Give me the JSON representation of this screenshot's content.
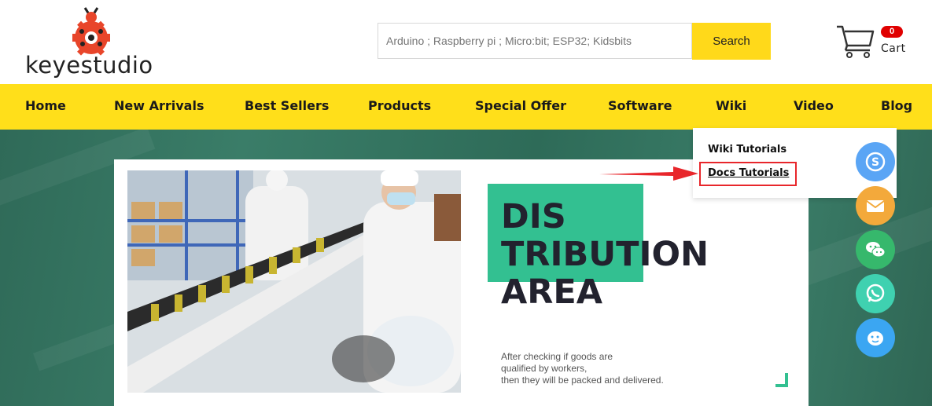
{
  "brand": {
    "name": "keyestudio",
    "colors": {
      "logo_red": "#e8452a",
      "accent_yellow": "#ffdf1a",
      "hero_green": "#33c091"
    }
  },
  "search": {
    "placeholder": "Arduino ; Raspberry pi ; Micro:bit; ESP32; Kidsbits",
    "button_label": "Search"
  },
  "cart": {
    "icon": "shopping-cart-icon",
    "count": "0",
    "label": "Cart"
  },
  "nav": {
    "items": [
      {
        "label": "Home"
      },
      {
        "label": "New Arrivals"
      },
      {
        "label": "Best Sellers"
      },
      {
        "label": "Products"
      },
      {
        "label": "Special Offer"
      },
      {
        "label": "Software"
      },
      {
        "label": "Wiki"
      },
      {
        "label": "Video"
      },
      {
        "label": "Blog"
      }
    ]
  },
  "wiki_dropdown": {
    "items": [
      {
        "label": "Wiki Tutorials"
      },
      {
        "label": "Docs Tutorials",
        "highlighted": true
      }
    ]
  },
  "hero": {
    "headline_lines": [
      "DIS",
      "TRIBUTION",
      "AREA"
    ],
    "description_lines": [
      "After checking if goods are",
      "qualified by workers,",
      "then they will be packed and delivered."
    ]
  },
  "contact_buttons": [
    {
      "icon": "skype-icon",
      "color": "#5aa5f5"
    },
    {
      "icon": "email-icon",
      "color": "#f3a93b"
    },
    {
      "icon": "wechat-icon",
      "color": "#36b86c"
    },
    {
      "icon": "whatsapp-icon",
      "color": "#3fd1b0"
    },
    {
      "icon": "qq-chat-icon",
      "color": "#3ba6f2"
    }
  ]
}
